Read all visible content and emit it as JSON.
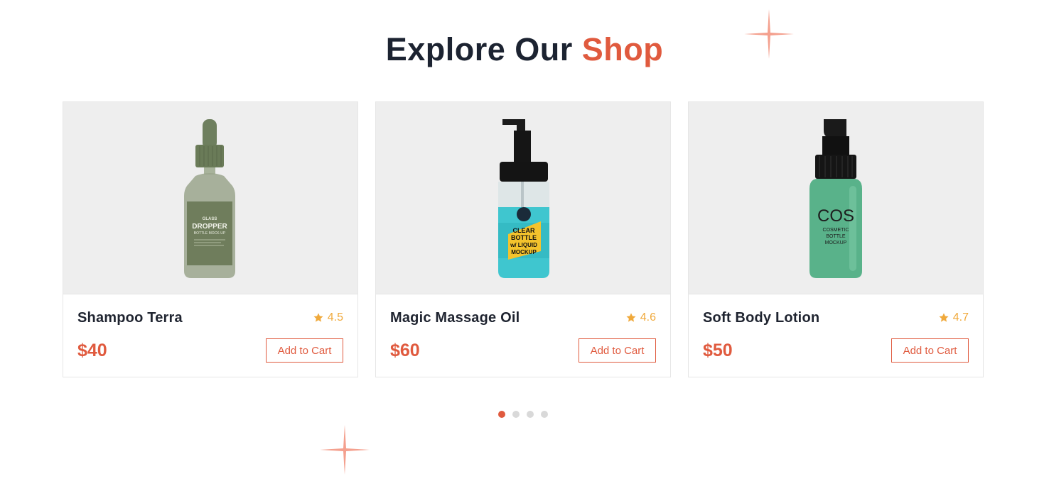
{
  "header": {
    "title_main": "Explore Our",
    "title_accent": "Shop"
  },
  "colors": {
    "accent": "#e05a3e",
    "star": "#f0a93b",
    "image_bg": "#eeeeee"
  },
  "products": [
    {
      "name": "Shampoo Terra",
      "rating": "4.5",
      "price": "$40",
      "cta": "Add to Cart",
      "image_icon": "dropper-bottle-icon",
      "label_lines": [
        "GLASS",
        "DROPPER",
        "BOTTLE MOCK-UP"
      ]
    },
    {
      "name": "Magic Massage Oil",
      "rating": "4.6",
      "price": "$60",
      "cta": "Add to Cart",
      "image_icon": "pump-bottle-icon",
      "label_lines": [
        "CLEAR",
        "BOTTLE",
        "w/ LIQUID",
        "MOCKUP"
      ]
    },
    {
      "name": "Soft Body Lotion",
      "rating": "4.7",
      "price": "$50",
      "cta": "Add to Cart",
      "image_icon": "lotion-bottle-icon",
      "label_lines": [
        "COS",
        "COSMETIC",
        "BOTTLE",
        "MOCKUP"
      ]
    }
  ],
  "carousel": {
    "total_slides": 4,
    "active_slide": 1
  }
}
